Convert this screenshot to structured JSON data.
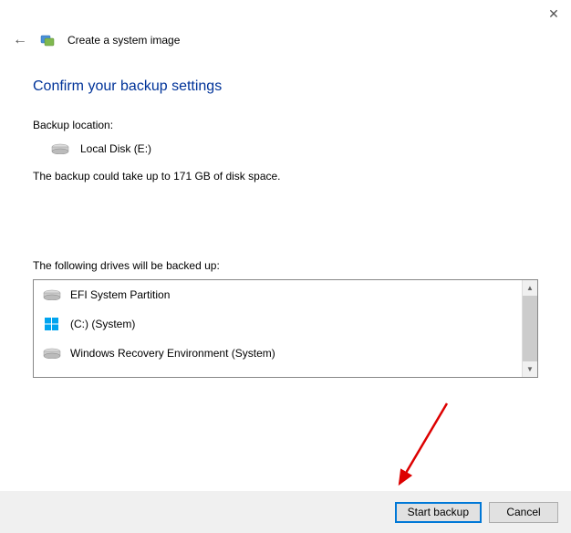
{
  "titlebar": {
    "close_glyph": "✕"
  },
  "header": {
    "back_glyph": "←",
    "title": "Create a system image"
  },
  "content": {
    "heading": "Confirm your backup settings",
    "location_label": "Backup location:",
    "location_value": "Local Disk (E:)",
    "space_info": "The backup could take up to 171 GB of disk space.",
    "drives_label": "The following drives will be backed up:",
    "drives": [
      {
        "icon": "disk",
        "label": "EFI System Partition"
      },
      {
        "icon": "windows",
        "label": "(C:) (System)"
      },
      {
        "icon": "disk",
        "label": "Windows Recovery Environment (System)"
      }
    ]
  },
  "buttons": {
    "start": "Start backup",
    "cancel": "Cancel"
  }
}
